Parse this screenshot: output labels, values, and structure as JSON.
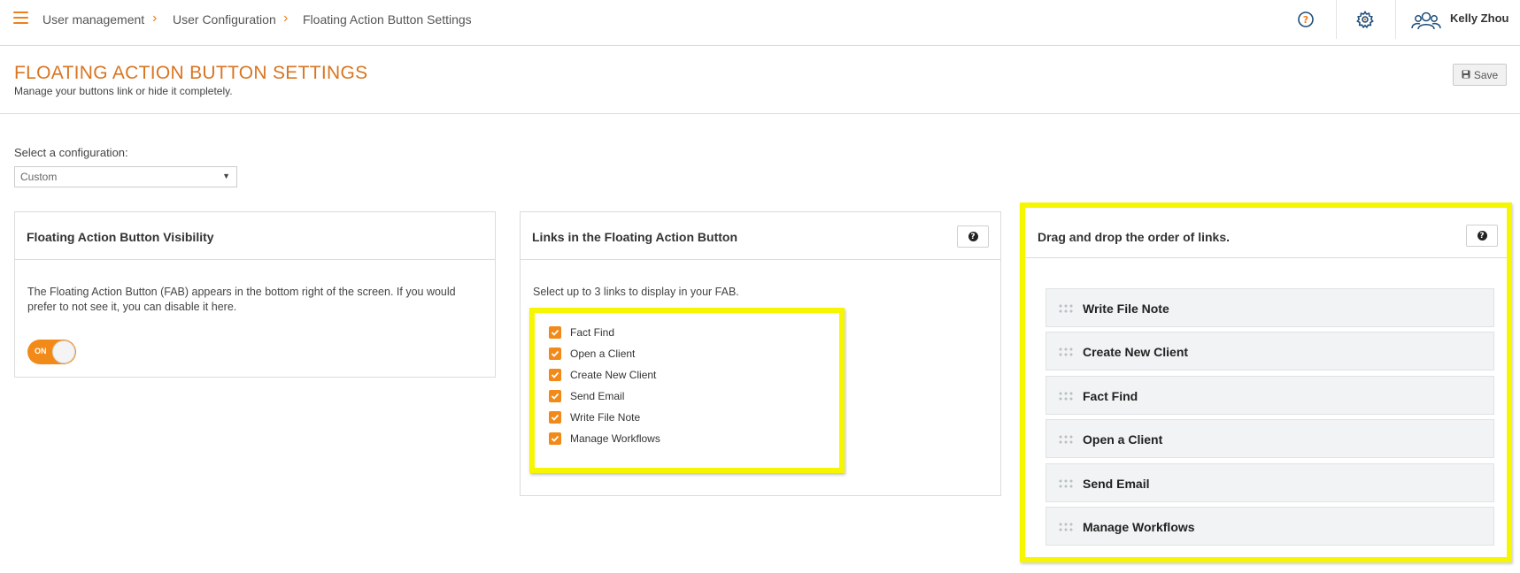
{
  "breadcrumb": {
    "items": [
      "User management",
      "User Configuration",
      "Floating Action Button Settings"
    ]
  },
  "topbar": {
    "help_icon": "help-circle-icon",
    "settings_icon": "gear-icon",
    "user_icon": "users-icon",
    "user_name": "Kelly Zhou"
  },
  "header": {
    "title": "FLOATING ACTION BUTTON SETTINGS",
    "subtitle": "Manage your buttons link or hide it completely.",
    "save_label": "Save",
    "save_icon": "floppy-disk-icon"
  },
  "config": {
    "label": "Select a configuration:",
    "selected": "Custom"
  },
  "visibility_panel": {
    "title": "Floating Action Button Visibility",
    "description_line1": "The Floating Action Button (FAB) appears in the bottom right of the screen. If you would",
    "description_line2": "prefer to not see it, you can disable it here.",
    "toggle_label": "ON",
    "toggle_on": true
  },
  "links_panel": {
    "title": "Links in the Floating Action Button",
    "instruction": "Select up to 3 links to display in your FAB.",
    "links": [
      {
        "label": "Fact Find",
        "checked": true
      },
      {
        "label": "Open a Client",
        "checked": true
      },
      {
        "label": "Create New Client",
        "checked": true
      },
      {
        "label": "Send Email",
        "checked": true
      },
      {
        "label": "Write File Note",
        "checked": true
      },
      {
        "label": "Manage Workflows",
        "checked": true
      }
    ]
  },
  "order_panel": {
    "title": "Drag and drop the order of links.",
    "items": [
      "Write File Note",
      "Create New Client",
      "Fact Find",
      "Open a Client",
      "Send Email",
      "Manage Workflows"
    ]
  },
  "colors": {
    "accent": "#ee7f1a",
    "title": "#d97521",
    "highlight": "#f6f600",
    "drag_item_bg": "#f1f3f4"
  }
}
